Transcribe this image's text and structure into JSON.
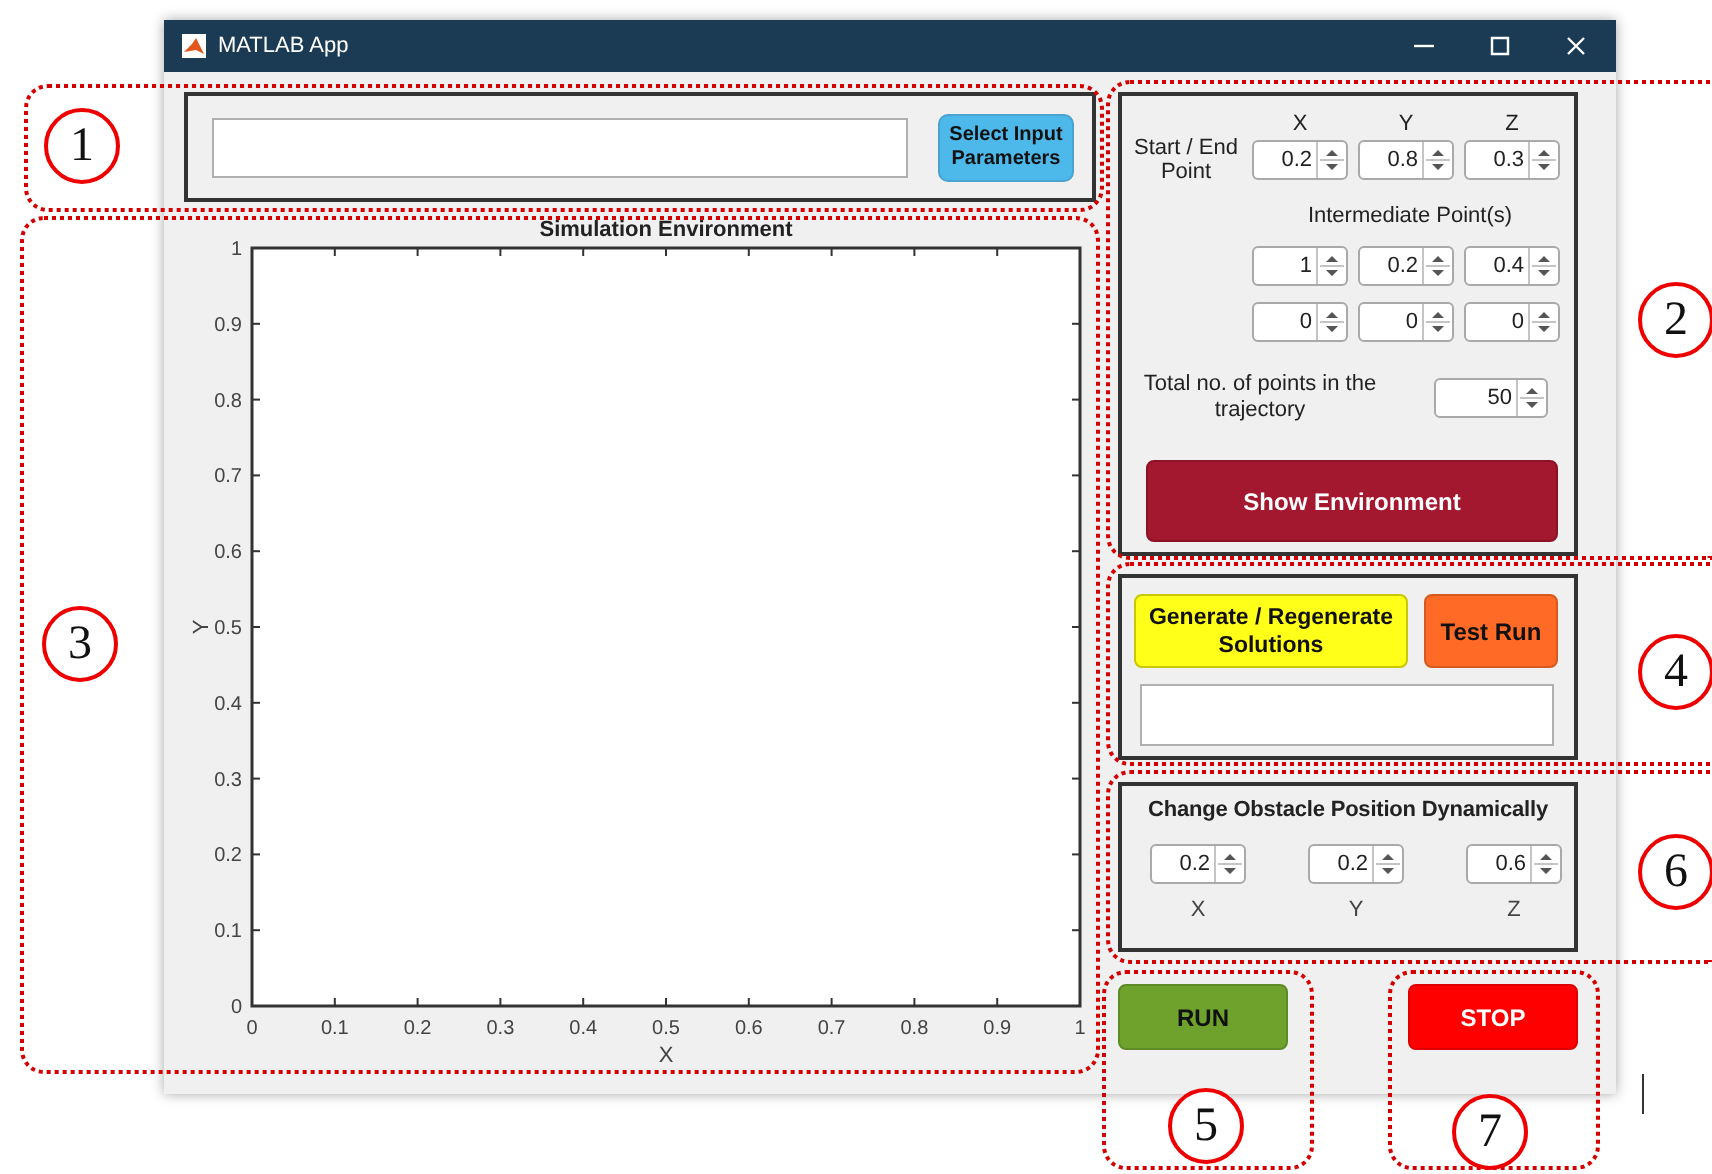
{
  "window": {
    "title": "MATLAB App"
  },
  "input_panel": {
    "button": "Select Input Parameters"
  },
  "axes": {
    "chart_data": {
      "type": "line",
      "title": "Simulation Environment",
      "xlabel": "X",
      "ylabel": "Y",
      "xlim": [
        0,
        1
      ],
      "ylim": [
        0,
        1
      ],
      "xticks": [
        0,
        0.1,
        0.2,
        0.3,
        0.4,
        0.5,
        0.6,
        0.7,
        0.8,
        0.9,
        1
      ],
      "yticks": [
        0,
        0.1,
        0.2,
        0.3,
        0.4,
        0.5,
        0.6,
        0.7,
        0.8,
        0.9,
        1
      ]
    }
  },
  "points_panel": {
    "columns": [
      "X",
      "Y",
      "Z"
    ],
    "start_end_label": "Start / End Point",
    "start_end": [
      "0.2",
      "0.8",
      "0.3"
    ],
    "intermediate_label": "Intermediate Point(s)",
    "intermediate": [
      [
        "1",
        "0.2",
        "0.4"
      ],
      [
        "0",
        "0",
        "0"
      ]
    ],
    "total_label": "Total no. of points in the trajectory",
    "total": "50",
    "button": "Show Environment"
  },
  "solutions_panel": {
    "generate_button": "Generate / Regenerate Solutions",
    "test_button": "Test Run"
  },
  "obstacle_panel": {
    "title": "Change Obstacle Position Dynamically",
    "spinners": [
      {
        "value": "0.2",
        "axis": "X"
      },
      {
        "value": "0.2",
        "axis": "Y"
      },
      {
        "value": "0.6",
        "axis": "Z"
      }
    ]
  },
  "run_button": "RUN",
  "stop_button": "STOP",
  "callouts": [
    {
      "label": "1"
    },
    {
      "label": "2"
    },
    {
      "label": "3"
    },
    {
      "label": "4"
    },
    {
      "label": "6"
    },
    {
      "label": "5"
    },
    {
      "label": "7"
    }
  ]
}
